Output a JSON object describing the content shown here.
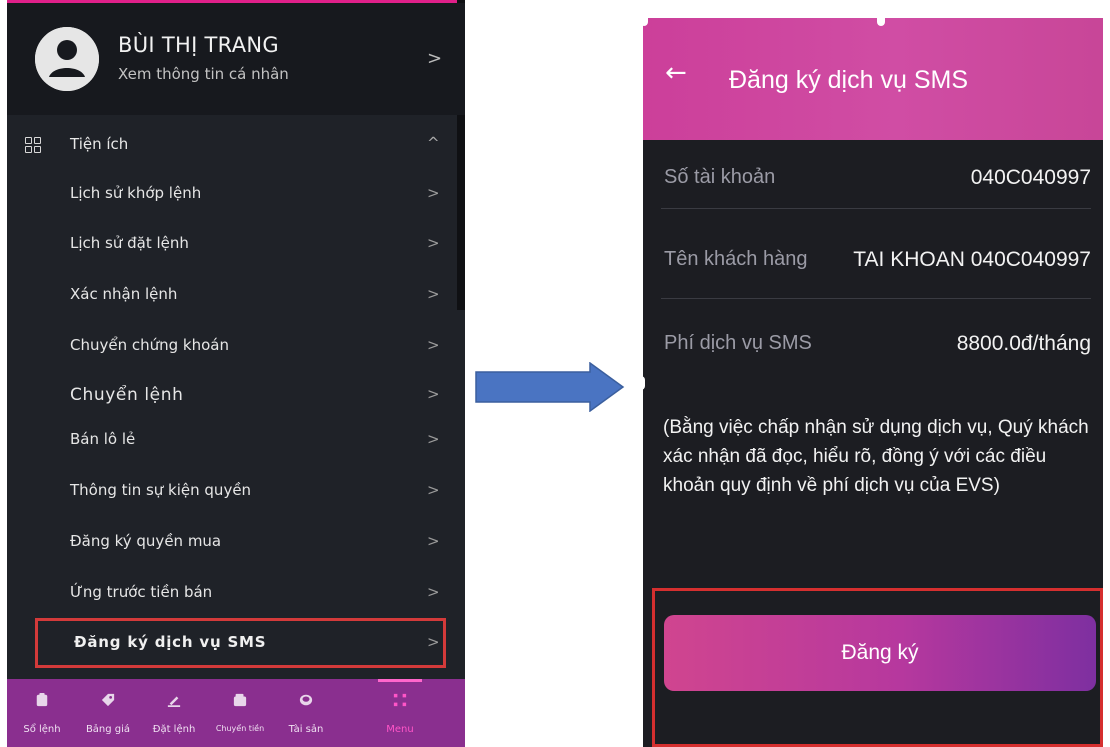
{
  "left": {
    "profile": {
      "name": "BÙI THỊ TRANG",
      "subtitle": "Xem thông tin cá nhân",
      "chevron": ">"
    },
    "section": {
      "label": "Tiện ích",
      "caret": "^"
    },
    "items": [
      {
        "label": "Lịch sử khớp lệnh"
      },
      {
        "label": "Lịch sử đặt lệnh"
      },
      {
        "label": "Xác nhận lệnh"
      },
      {
        "label": "Chuyển chứng khoán"
      },
      {
        "label": "Chuyển lệnh"
      },
      {
        "label": "Bán lô lẻ"
      },
      {
        "label": "Thông tin sự kiện quyền"
      },
      {
        "label": "Đăng ký quyền mua"
      },
      {
        "label": "Ứng trước tiền bán"
      },
      {
        "label": "Đăng ký dịch vụ SMS"
      }
    ],
    "chevron": ">",
    "bottom_nav": [
      {
        "label": "Sổ lệnh",
        "icon": "clipboard-icon"
      },
      {
        "label": "Bảng giá",
        "icon": "tag-icon"
      },
      {
        "label": "Đặt lệnh",
        "icon": "pen-icon"
      },
      {
        "label": "Chuyển tiền",
        "icon": "wallet-icon"
      },
      {
        "label": "Tài sản",
        "icon": "coins-icon"
      },
      {
        "label": "Menu",
        "icon": "grid-dots-icon",
        "active": true
      }
    ]
  },
  "right": {
    "header": {
      "back": "←",
      "title": "Đăng ký dịch vụ SMS"
    },
    "rows": [
      {
        "key": "Số tài khoản",
        "value": "040C040997"
      },
      {
        "key": "Tên khách hàng",
        "value": "TAI KHOAN 040C040997"
      },
      {
        "key": "Phí dịch vụ SMS",
        "value": "8800.0đ/tháng"
      }
    ],
    "notice": "(Bằng việc chấp nhận sử dụng dịch vụ, Quý khách xác nhận đã đọc, hiểu rõ, đồng ý với các điều khoản quy định về phí dịch vụ của EVS)",
    "register_button": "Đăng ký"
  },
  "colors": {
    "accent_pink": "#d04da4",
    "nav_purple": "#8a2f8f",
    "highlight_red": "#d33a3a",
    "arrow_blue": "#4a74c2"
  }
}
